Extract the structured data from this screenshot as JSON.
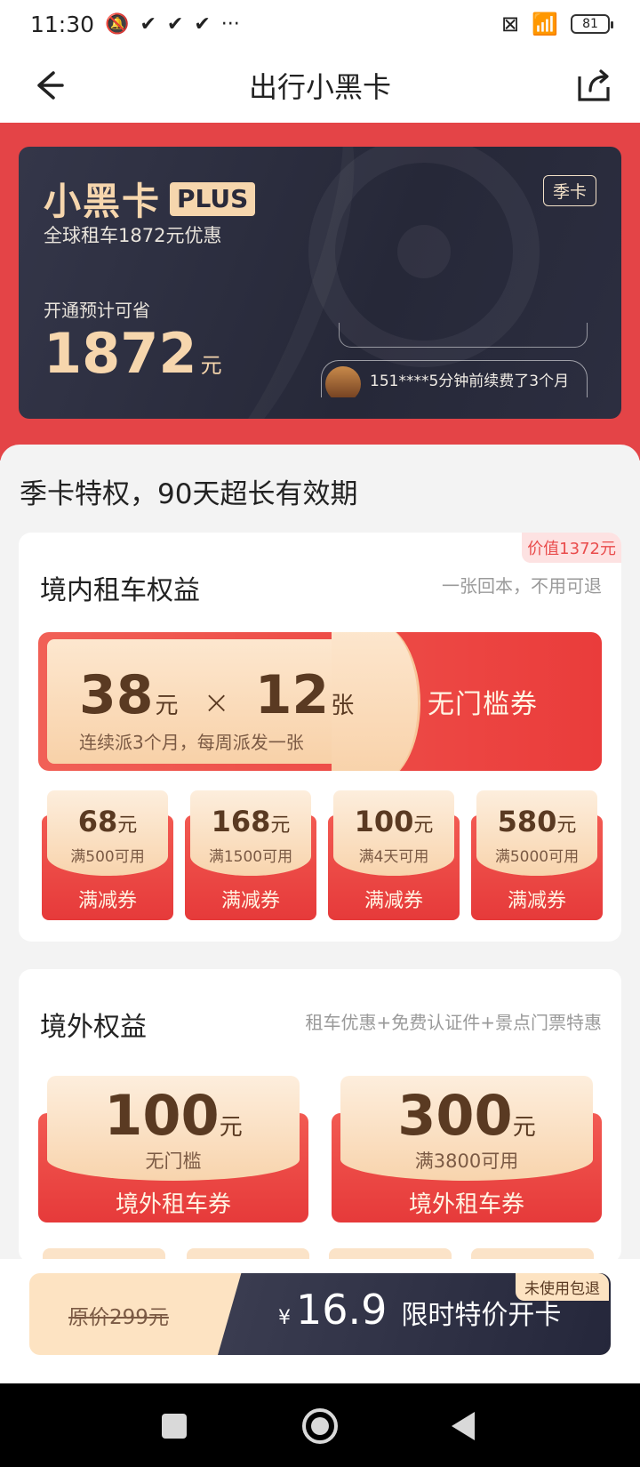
{
  "status": {
    "time": "11:30",
    "battery": "81",
    "more": "···"
  },
  "nav": {
    "title": "出行小黑卡"
  },
  "card": {
    "brand": "小黑卡",
    "plus": "PLUS",
    "season_tag": "季卡",
    "subtitle": "全球租车1872元优惠",
    "saving_label": "开通预计可省",
    "saving_value": "1872",
    "saving_unit": "元",
    "ticker": "151****5分钟前续费了3个月"
  },
  "section_title": "季卡特权，90天超长有效期",
  "domestic": {
    "title": "境内租车权益",
    "note": "一张回本，不用可退",
    "value_tag": "价值1372元",
    "big_coupon": {
      "amount": "38",
      "unit": "元",
      "times": "×",
      "count": "12",
      "count_unit": "张",
      "desc": "连续派3个月，每周派发一张",
      "label": "无门槛券"
    },
    "coupons": [
      {
        "amount": "68",
        "unit": "元",
        "cond": "满500可用",
        "label": "满减券"
      },
      {
        "amount": "168",
        "unit": "元",
        "cond": "满1500可用",
        "label": "满减券"
      },
      {
        "amount": "100",
        "unit": "元",
        "cond": "满4天可用",
        "label": "满减券"
      },
      {
        "amount": "580",
        "unit": "元",
        "cond": "满5000可用",
        "label": "满减券"
      }
    ]
  },
  "overseas": {
    "title": "境外权益",
    "note": "租车优惠+免费认证件+景点门票特惠",
    "coupons": [
      {
        "amount": "100",
        "unit": "元",
        "cond": "无门槛",
        "label": "境外租车券"
      },
      {
        "amount": "300",
        "unit": "元",
        "cond": "满3800可用",
        "label": "境外租车券"
      }
    ]
  },
  "purchase": {
    "original": "原价299元",
    "currency": "¥",
    "price": "16.9",
    "cta": "限时特价开卡",
    "badge": "未使用包退"
  },
  "colors": {
    "brand_red": "#e44447",
    "gold": "#f6d6ad",
    "dark_card": "#262838"
  }
}
